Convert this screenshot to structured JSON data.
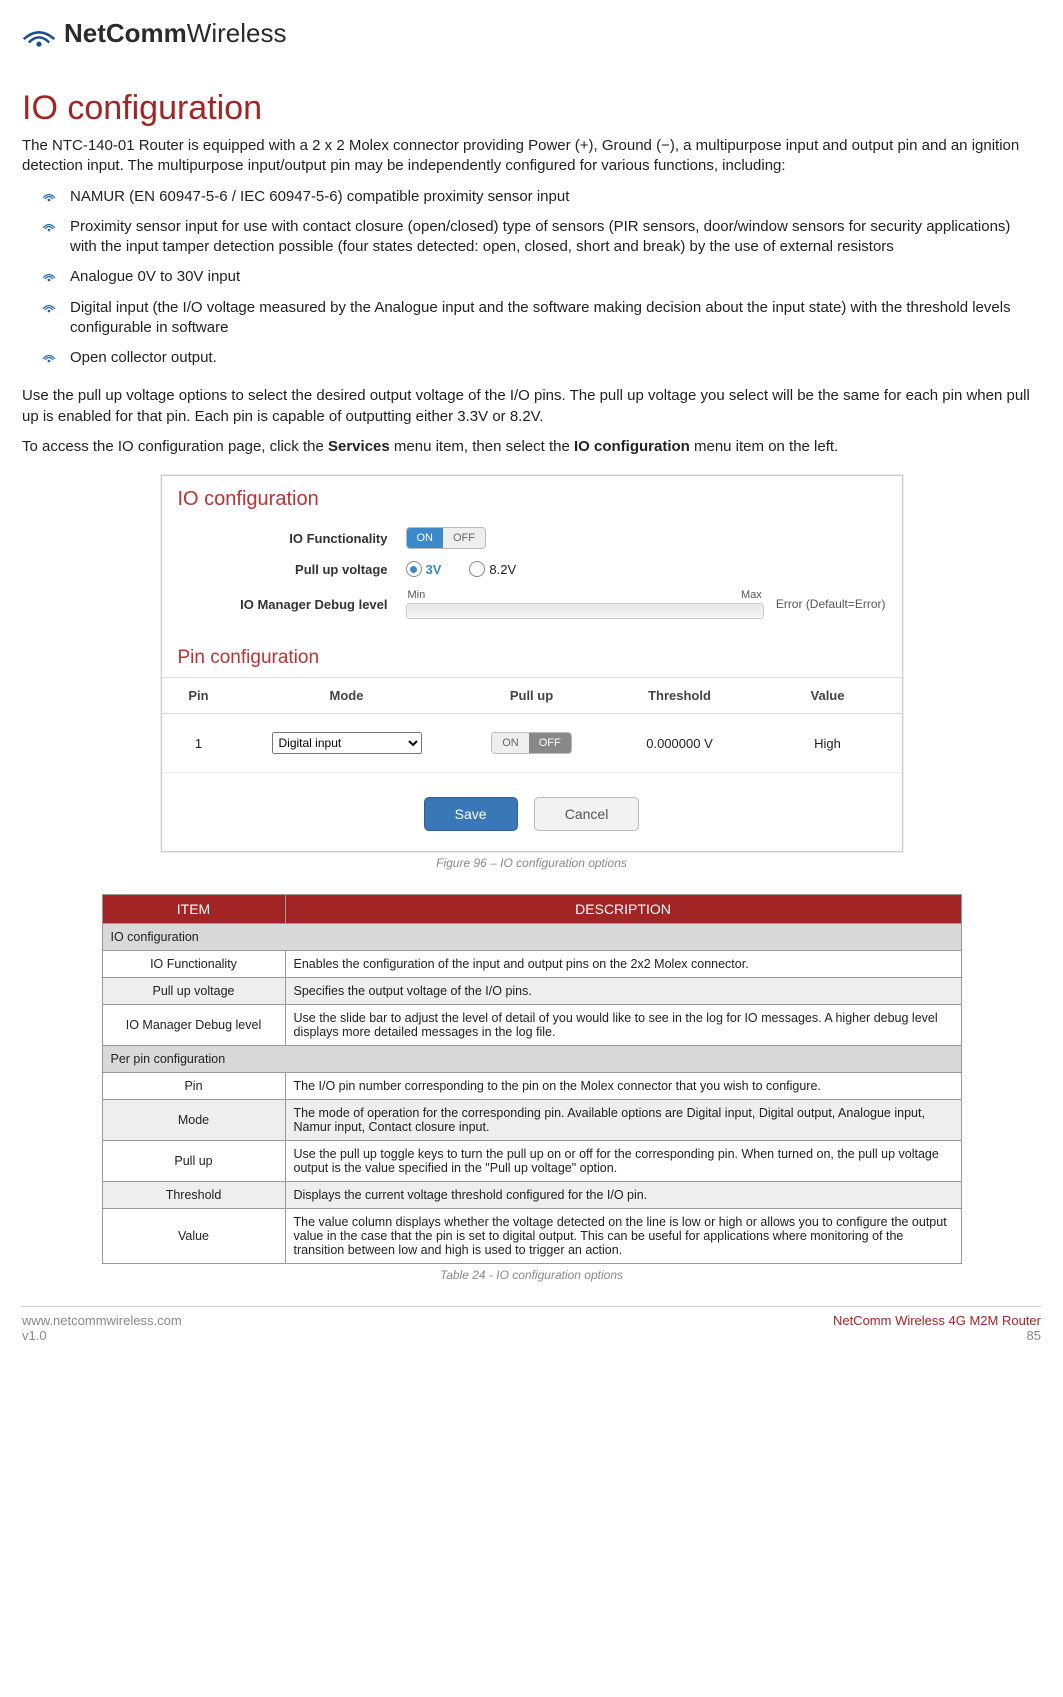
{
  "logo": {
    "bold": "NetComm",
    "light": "Wireless"
  },
  "heading": "IO configuration",
  "intro": "The NTC-140-01 Router is equipped with a 2 x 2 Molex connector providing Power (+), Ground (−), a multipurpose input and output pin and an ignition detection input. The multipurpose input/output pin may be independently configured for various functions, including:",
  "bullets": [
    "NAMUR (EN 60947-5-6 / IEC 60947-5-6) compatible proximity sensor input",
    "Proximity sensor input for use with contact closure (open/closed) type of sensors (PIR sensors, door/window sensors for security applications) with the input tamper detection possible (four states detected: open, closed, short and break) by the use of external resistors",
    "Analogue 0V to 30V input",
    "Digital input (the I/O voltage measured by the Analogue input and the software making decision about the input state) with the threshold levels configurable in software",
    "Open collector output."
  ],
  "para2": "Use the pull up voltage options to select the desired output voltage of the I/O pins. The pull up voltage you select will be the same for each pin when pull up is enabled for that pin. Each pin is capable of outputting either 3.3V or 8.2V.",
  "para3_pre": "To access the IO configuration page, click the ",
  "para3_b1": "Services",
  "para3_mid": " menu item, then select the ",
  "para3_b2": "IO configuration",
  "para3_post": " menu item on the left.",
  "shot": {
    "title": "IO configuration",
    "func_label": "IO Functionality",
    "toggle_on": "ON",
    "toggle_off": "OFF",
    "pull_label": "Pull up voltage",
    "v3": "3V",
    "v8": "8.2V",
    "dbg_label": "IO Manager Debug level",
    "min": "Min",
    "max": "Max",
    "dbg_val": "Error  (Default=Error)",
    "pin_title": "Pin configuration",
    "cols": {
      "pin": "Pin",
      "mode": "Mode",
      "pullup": "Pull up",
      "thresh": "Threshold",
      "value": "Value"
    },
    "row": {
      "pin": "1",
      "mode": "Digital input",
      "pull_on": "ON",
      "pull_off": "OFF",
      "thresh": "0.000000 V",
      "value": "High"
    },
    "save": "Save",
    "cancel": "Cancel"
  },
  "fig_caption": "Figure 96 – IO configuration options",
  "tbl": {
    "h_item": "ITEM",
    "h_desc": "DESCRIPTION",
    "sec1": "IO configuration",
    "rows1": [
      {
        "item": "IO Functionality",
        "desc": "Enables the configuration of the input and output pins on the 2x2 Molex connector."
      },
      {
        "item": "Pull up voltage",
        "desc": "Specifies the output voltage of the I/O pins."
      },
      {
        "item": "IO Manager Debug level",
        "desc": "Use the slide bar to adjust the level of detail of you would like to see in the log for IO messages. A higher debug level displays more detailed messages in the log file."
      }
    ],
    "sec2": "Per pin configuration",
    "rows2": [
      {
        "item": "Pin",
        "desc": "The I/O pin number corresponding to the pin on the Molex connector that you wish to configure."
      },
      {
        "item": "Mode",
        "desc": "The mode of operation for the corresponding pin. Available options are Digital input, Digital output, Analogue input, Namur input, Contact closure input."
      },
      {
        "item": "Pull up",
        "desc": "Use the pull up toggle keys to turn the pull up on or off for the corresponding pin. When turned on, the pull up voltage output is the value specified in the \"Pull up voltage\" option."
      },
      {
        "item": "Threshold",
        "desc": "Displays the current voltage threshold configured for the I/O pin."
      },
      {
        "item": "Value",
        "desc": "The value column displays whether the voltage detected on the line is low or high or allows you to configure the output value in the case that the pin is set to digital output. This can be useful for applications where monitoring of the transition between low and high is used to trigger an action."
      }
    ]
  },
  "tbl_caption": "Table 24 - IO configuration options",
  "footer": {
    "url": "www.netcommwireless.com",
    "ver": "v1.0",
    "product": "NetComm Wireless 4G M2M Router",
    "page": "85"
  }
}
